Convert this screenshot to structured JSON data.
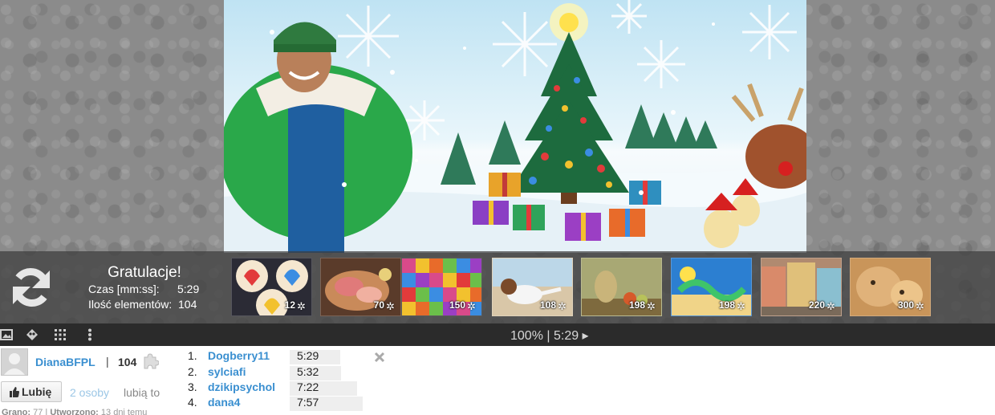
{
  "congrats": {
    "title": "Gratulacje!",
    "time_label": "Czas [mm:ss]:",
    "time_value": "5:29",
    "count_label": "Ilość elementów:",
    "count_value": "104"
  },
  "suggestions": [
    {
      "pieces": "12",
      "theme": "rainbow heart cupcakes"
    },
    {
      "pieces": "70",
      "theme": "ham and cheese platter"
    },
    {
      "pieces": "150",
      "theme": "colourful yarn skeins"
    },
    {
      "pieces": "108",
      "theme": "running terrier dog"
    },
    {
      "pieces": "198",
      "theme": "still life with jug and fruit"
    },
    {
      "pieces": "198",
      "theme": "summer lettering"
    },
    {
      "pieces": "220",
      "theme": "colourful village street"
    },
    {
      "pieces": "300",
      "theme": "lioness and cub"
    }
  ],
  "status": {
    "text": "100% | 5:29 ▸"
  },
  "user": {
    "name": "DianaBFPL",
    "separator": "|",
    "score": "104"
  },
  "like": {
    "button_label": "Lubię",
    "people": "2 osoby",
    "suffix": "lubią to"
  },
  "meta": {
    "played_label": "Grano:",
    "played_value": "77",
    "created_label": "Utworzono:",
    "created_value": "13 dni temu"
  },
  "ranking": [
    {
      "pos": "1.",
      "name": "Dogberry11",
      "time": "5:29"
    },
    {
      "pos": "2.",
      "name": "sylciafi",
      "time": "5:32"
    },
    {
      "pos": "3.",
      "name": "dzikipsychol",
      "time": "7:22"
    },
    {
      "pos": "4.",
      "name": "dana4",
      "time": "7:57"
    }
  ],
  "colors": {
    "link": "#3a8fd0",
    "toolbar": "#2b2b2b",
    "overlay": "rgba(60,60,60,0.72)"
  },
  "icons": [
    "reload-icon",
    "image-icon",
    "palette-icon",
    "grid-icon",
    "more-icon",
    "puzzle-piece-icon",
    "thumb-up-icon",
    "close-icon"
  ]
}
